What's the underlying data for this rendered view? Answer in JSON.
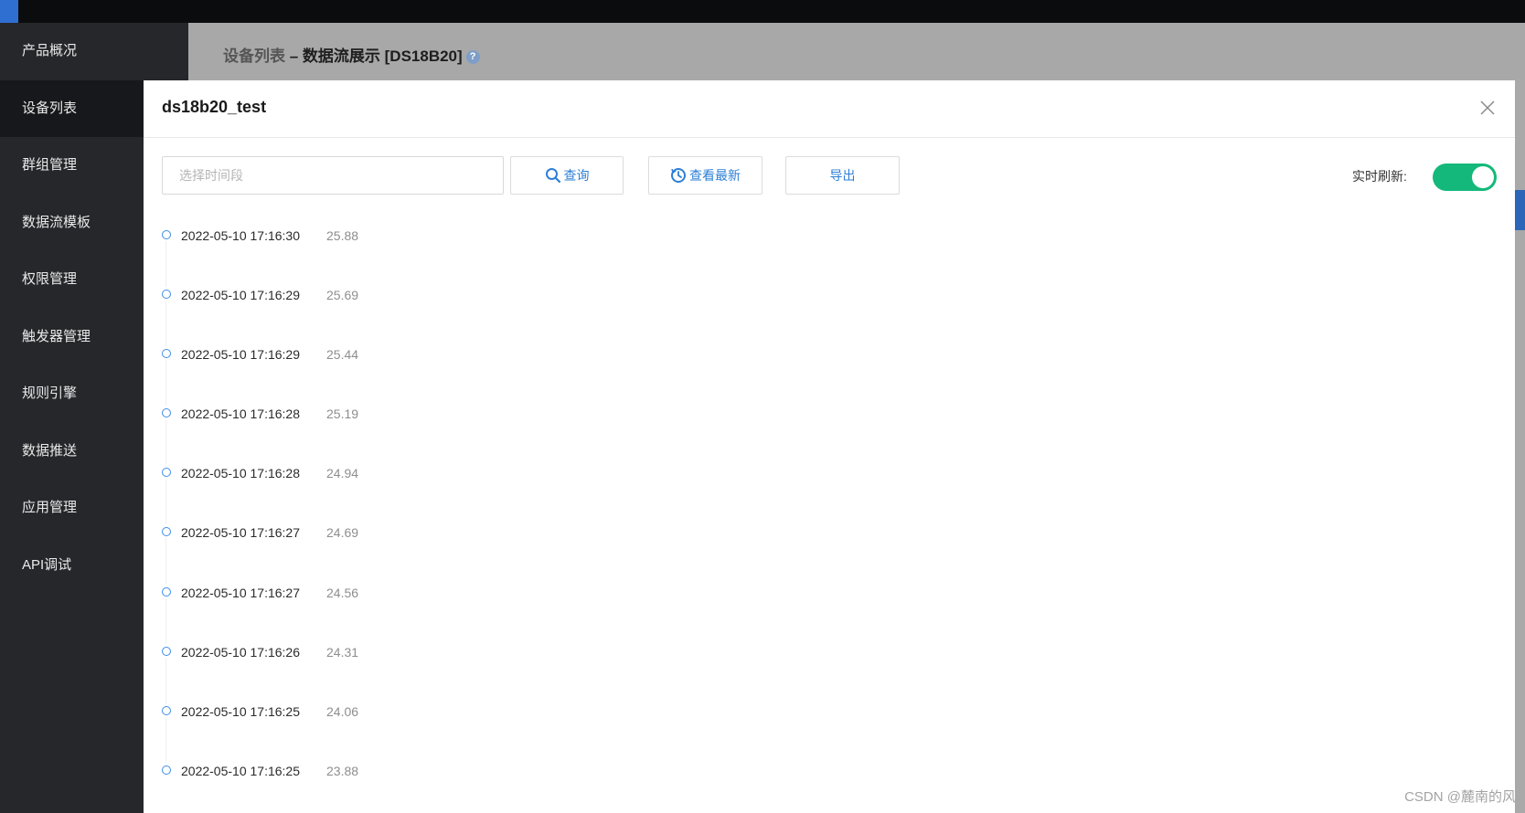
{
  "sidebar": {
    "items": [
      {
        "label": "产品概况"
      },
      {
        "label": "设备列表"
      },
      {
        "label": "群组管理"
      },
      {
        "label": "数据流模板"
      },
      {
        "label": "权限管理"
      },
      {
        "label": "触发器管理"
      },
      {
        "label": "规则引擎"
      },
      {
        "label": "数据推送"
      },
      {
        "label": "应用管理"
      },
      {
        "label": "API调试"
      }
    ],
    "active_index": 1
  },
  "background_page": {
    "breadcrumb_link": "设备列表",
    "breadcrumb_separator": " – ",
    "breadcrumb_current": "数据流展示 [DS18B20]",
    "help_icon_glyph": "?"
  },
  "modal": {
    "title": "ds18b20_test",
    "time_input_placeholder": "选择时间段",
    "query_label": "查询",
    "latest_label": "查看最新",
    "export_label": "导出",
    "refresh_label": "实时刷新:",
    "refresh_enabled": true,
    "entries": [
      {
        "time": "2022-05-10 17:16:30",
        "value": "25.88"
      },
      {
        "time": "2022-05-10 17:16:29",
        "value": "25.69"
      },
      {
        "time": "2022-05-10 17:16:29",
        "value": "25.44"
      },
      {
        "time": "2022-05-10 17:16:28",
        "value": "25.19"
      },
      {
        "time": "2022-05-10 17:16:28",
        "value": "24.94"
      },
      {
        "time": "2022-05-10 17:16:27",
        "value": "24.69"
      },
      {
        "time": "2022-05-10 17:16:27",
        "value": "24.56"
      },
      {
        "time": "2022-05-10 17:16:26",
        "value": "24.31"
      },
      {
        "time": "2022-05-10 17:16:25",
        "value": "24.06"
      },
      {
        "time": "2022-05-10 17:16:25",
        "value": "23.88"
      }
    ]
  },
  "watermark": "CSDN @麓南的风",
  "colors": {
    "sidebar_bg": "#26272b",
    "sidebar_active_bg": "#17181b",
    "accent_blue": "#2d7fd6",
    "toggle_on": "#14b87a"
  },
  "icons": {
    "query": "search-icon",
    "latest": "refresh-icon",
    "close": "close-icon",
    "timeline_dot": "circle-icon"
  }
}
